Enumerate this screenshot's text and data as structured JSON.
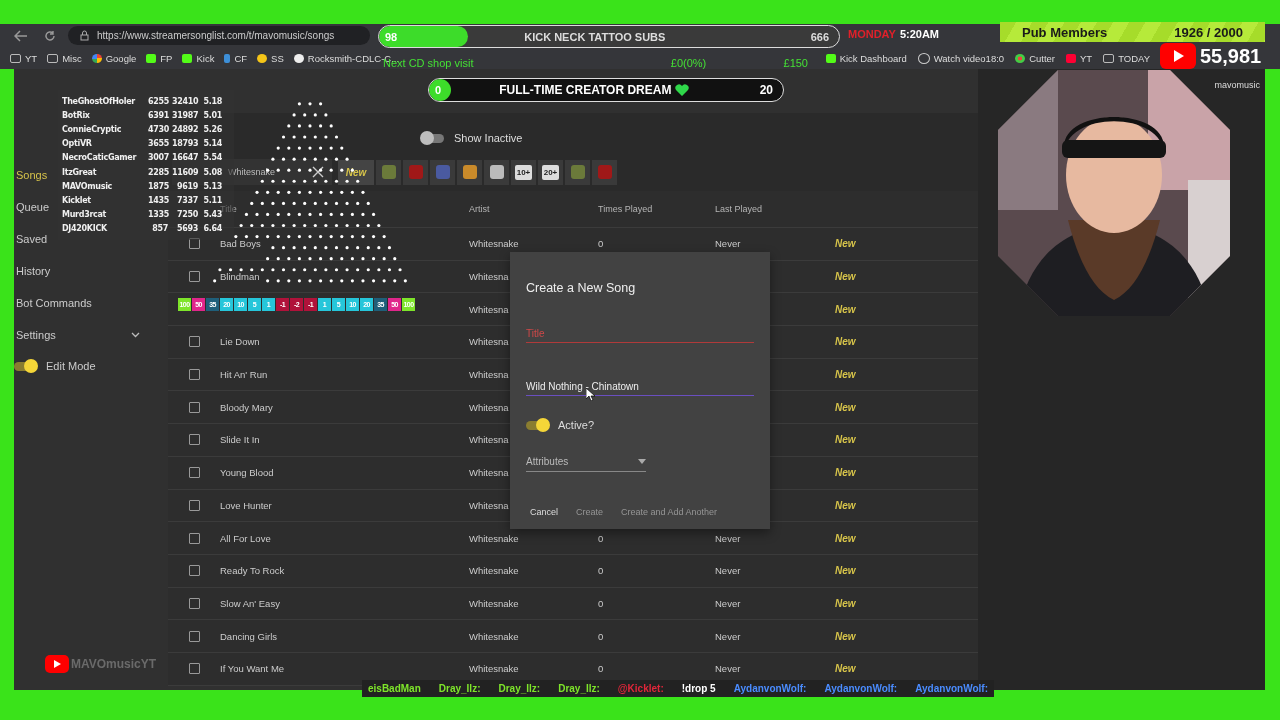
{
  "browser": {
    "url": "https://www.streamersonglist.com/t/mavomusic/songs",
    "bookmarks": [
      {
        "label": "YT",
        "kind": "folder"
      },
      {
        "label": "Misc",
        "kind": "folder"
      },
      {
        "label": "Google",
        "kind": "google"
      },
      {
        "label": "FP",
        "kind": "kick"
      },
      {
        "label": "Kick",
        "kind": "kick"
      },
      {
        "label": "CF",
        "kind": "bar"
      },
      {
        "label": "SS",
        "kind": "note"
      },
      {
        "label": "Rocksmith-CDLC-C...",
        "kind": "github"
      }
    ],
    "bookmarks_right": [
      {
        "label": "Kick Dashboard",
        "kind": "kick"
      },
      {
        "label": "Watch video18:0",
        "kind": "globe"
      },
      {
        "label": "Cutter",
        "kind": "dots"
      },
      {
        "label": "YT",
        "kind": "yt"
      },
      {
        "label": "TODAY",
        "kind": "folder"
      }
    ]
  },
  "sidebar": {
    "items": [
      {
        "label": "Songs",
        "selected": true
      },
      {
        "label": "Queue",
        "selected": false
      },
      {
        "label": "Saved",
        "selected": false
      },
      {
        "label": "History",
        "selected": false
      },
      {
        "label": "Bot Commands",
        "selected": false
      },
      {
        "label": "Settings",
        "selected": false,
        "expandable": true
      }
    ],
    "edit_mode": {
      "label": "Edit Mode",
      "on": true
    }
  },
  "toolbar": {
    "show_inactive": {
      "label": "Show Inactive",
      "on": false
    },
    "search": {
      "value": "Whitesnake"
    },
    "filters": [
      {
        "kind": "tag",
        "label": "New",
        "selected": true
      },
      {
        "kind": "icon",
        "selected": false
      },
      {
        "kind": "icon",
        "selected": false
      },
      {
        "kind": "icon",
        "selected": false
      },
      {
        "kind": "icon",
        "selected": false
      },
      {
        "kind": "icon",
        "selected": false
      },
      {
        "kind": "text",
        "label": "10+",
        "selected": false
      },
      {
        "kind": "text",
        "label": "20+",
        "selected": false
      },
      {
        "kind": "icon",
        "selected": false
      },
      {
        "kind": "icon",
        "selected": false
      }
    ]
  },
  "table": {
    "columns": [
      "Title",
      "Artist",
      "Times Played",
      "Last Played"
    ],
    "rows": [
      {
        "checked": false,
        "title": "Bad Boys",
        "artist": "Whitesnake",
        "times": "0",
        "last": "Never",
        "tag": "New"
      },
      {
        "checked": false,
        "title": "Blindman",
        "artist": "Whitesna",
        "tag": "New"
      },
      {
        "artist": "Whitesna",
        "tag": "New"
      },
      {
        "checked": false,
        "title": "Lie Down",
        "artist": "Whitesna",
        "tag": "New"
      },
      {
        "checked": false,
        "title": "Hit An' Run",
        "artist": "Whitesna",
        "tag": "New"
      },
      {
        "checked": false,
        "title": "Bloody Mary",
        "artist": "Whitesna",
        "tag": "New"
      },
      {
        "checked": false,
        "title": "Slide It In",
        "artist": "Whitesna",
        "tag": "New"
      },
      {
        "checked": false,
        "title": "Young Blood",
        "artist": "Whitesna",
        "tag": "New"
      },
      {
        "checked": false,
        "title": "Love Hunter",
        "artist": "Whitesna",
        "tag": "New"
      },
      {
        "checked": false,
        "title": "All For Love",
        "artist": "Whitesnake",
        "times": "0",
        "last": "Never",
        "tag": "New"
      },
      {
        "checked": false,
        "title": "Ready To Rock",
        "artist": "Whitesnake",
        "times": "0",
        "last": "Never",
        "tag": "New"
      },
      {
        "checked": false,
        "title": "Slow An' Easy",
        "artist": "Whitesnake",
        "times": "0",
        "last": "Never",
        "tag": "New"
      },
      {
        "checked": false,
        "title": "Dancing Girls",
        "artist": "Whitesnake",
        "times": "0",
        "last": "Never",
        "tag": "New"
      },
      {
        "checked": false,
        "title": "If You Want Me",
        "artist": "Whitesnake",
        "times": "0",
        "last": "Never",
        "tag": "New"
      }
    ]
  },
  "dialog": {
    "title": "Create a New Song",
    "title_field": {
      "placeholder": "Title"
    },
    "artist_field": {
      "value": "Wild Nothing - Chinatown"
    },
    "active": {
      "label": "Active?",
      "on": true
    },
    "attributes": {
      "placeholder": "Attributes"
    },
    "buttons": [
      {
        "label": "Cancel",
        "disabled": false
      },
      {
        "label": "Create",
        "disabled": true
      },
      {
        "label": "Create and Add Another",
        "disabled": true
      }
    ]
  },
  "overlay": {
    "leaderboard": [
      {
        "name": "TheGhostOfHoler",
        "a": "6255",
        "b": "32410",
        "c": "5.18"
      },
      {
        "name": "BotRix",
        "a": "6391",
        "b": "31987",
        "c": "5.01"
      },
      {
        "name": "ConnieCryptic",
        "a": "4730",
        "b": "24892",
        "c": "5.26"
      },
      {
        "name": "OptiVR",
        "a": "3655",
        "b": "18793",
        "c": "5.14"
      },
      {
        "name": "NecroCaticGamer",
        "a": "3007",
        "b": "16647",
        "c": "5.54"
      },
      {
        "name": "ItzGreat",
        "a": "2285",
        "b": "11609",
        "c": "5.08"
      },
      {
        "name": "MAVOmusic",
        "a": "1875",
        "b": "9619",
        "c": "5.13"
      },
      {
        "name": "Kicklet",
        "a": "1435",
        "b": "7337",
        "c": "5.11"
      },
      {
        "name": "Murd3rcat",
        "a": "1335",
        "b": "7250",
        "c": "5.43"
      },
      {
        "name": "DJ420KICK",
        "a": "857",
        "b": "5693",
        "c": "6.64"
      }
    ],
    "buckets": [
      {
        "label": "100",
        "color": "#7ee52a"
      },
      {
        "label": "50",
        "color": "#e0268a"
      },
      {
        "label": "35",
        "color": "#1f5f7a"
      },
      {
        "label": "20",
        "color": "#26c6da"
      },
      {
        "label": "10",
        "color": "#26c6da"
      },
      {
        "label": "5",
        "color": "#26c6da"
      },
      {
        "label": "1",
        "color": "#26c6da"
      },
      {
        "label": "-1",
        "color": "#b0123a"
      },
      {
        "label": "-2",
        "color": "#b0123a"
      },
      {
        "label": "-1",
        "color": "#b0123a"
      },
      {
        "label": "1",
        "color": "#26c6da"
      },
      {
        "label": "5",
        "color": "#26c6da"
      },
      {
        "label": "10",
        "color": "#26c6da"
      },
      {
        "label": "20",
        "color": "#26c6da"
      },
      {
        "label": "35",
        "color": "#1f5f7a"
      },
      {
        "label": "50",
        "color": "#e0268a"
      },
      {
        "label": "100",
        "color": "#7ee52a"
      }
    ],
    "goal_subs": {
      "label": "KICK NECK TATTOO SUBS",
      "current": "98",
      "target": "666",
      "level": 0.15
    },
    "shop": {
      "label": "Next CD shop visit",
      "current": "£0(0%)",
      "target": "£150"
    },
    "goal_dream": {
      "label": "FULL-TIME CREATOR DREAM",
      "current": "0",
      "target": "20",
      "level": 0
    },
    "clock": {
      "day": "MONDAY",
      "time": "5:20AM"
    },
    "pub": {
      "label": "Pub Members",
      "count": "1926 / 2000"
    },
    "youtube": {
      "count": "55,981"
    },
    "cam_label": "mavomusic",
    "channel": "MAVOmusicYT",
    "chat": [
      {
        "text": "eisBadMan",
        "color": "#7ee52a"
      },
      {
        "text": "Dray_Ilz:",
        "color": "#7ee52a"
      },
      {
        "text": "Dray_Ilz:",
        "color": "#7ee52a"
      },
      {
        "text": "Dray_Ilz:",
        "color": "#7ee52a"
      },
      {
        "text": "@Kicklet:",
        "color": "#e0263a"
      },
      {
        "text": "!drop 5",
        "color": "#ffffff"
      },
      {
        "text": "AydanvonWolf:",
        "color": "#4a8cff"
      },
      {
        "text": "AydanvonWolf:",
        "color": "#4a8cff"
      },
      {
        "text": "AydanvonWolf:",
        "color": "#4a8cff"
      }
    ]
  }
}
